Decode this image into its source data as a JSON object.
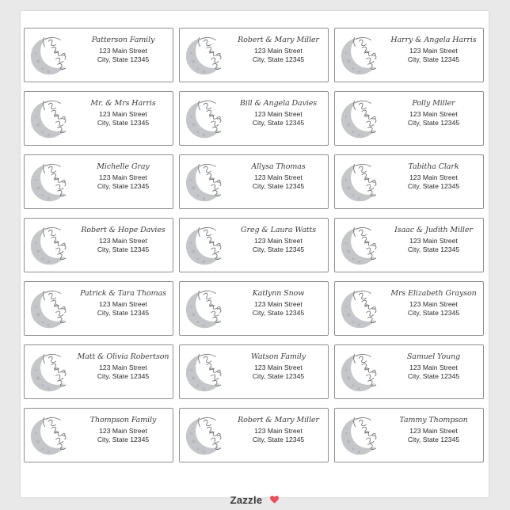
{
  "artwork": {
    "script_text": "I love you to the moon"
  },
  "labels": [
    {
      "name": "Patterson Family",
      "line1": "123 Main Street",
      "line2": "City, State 12345"
    },
    {
      "name": "Robert & Mary Miller",
      "line1": "123 Main Street",
      "line2": "City, State 12345"
    },
    {
      "name": "Harry & Angela Harris",
      "line1": "123 Main Street",
      "line2": "City, State 12345"
    },
    {
      "name": "Mr. & Mrs Harris",
      "line1": "123 Main Street",
      "line2": "City, State 12345"
    },
    {
      "name": "Bill & Angela Davies",
      "line1": "123 Main Street",
      "line2": "City, State 12345"
    },
    {
      "name": "Polly Miller",
      "line1": "123 Main Street",
      "line2": "City, State 12345"
    },
    {
      "name": "Michelle Gray",
      "line1": "123 Main Street",
      "line2": "City, State 12345"
    },
    {
      "name": "Allysa Thomas",
      "line1": "123 Main Street",
      "line2": "City, State 12345"
    },
    {
      "name": "Tabitha Clark",
      "line1": "123 Main Street",
      "line2": "City, State 12345"
    },
    {
      "name": "Robert & Hope Davies",
      "line1": "123 Main Street",
      "line2": "City, State 12345"
    },
    {
      "name": "Greg & Laura Watts",
      "line1": "123 Main Street",
      "line2": "City, State 12345"
    },
    {
      "name": "Isaac & Judith Miller",
      "line1": "123 Main Street",
      "line2": "City, State 12345"
    },
    {
      "name": "Patrick & Tara Thomas",
      "line1": "123 Main Street",
      "line2": "City, State 12345"
    },
    {
      "name": "Katlynn Snow",
      "line1": "123 Main Street",
      "line2": "City, State 12345"
    },
    {
      "name": "Mrs Elizabeth Grayson",
      "line1": "123 Main Street",
      "line2": "City, State 12345"
    },
    {
      "name": "Matt & Olivia Robertson",
      "line1": "123 Main Street",
      "line2": "City, State 12345"
    },
    {
      "name": "Watson Family",
      "line1": "123 Main Street",
      "line2": "City, State 12345"
    },
    {
      "name": "Samuel Young",
      "line1": "123 Main Street",
      "line2": "City, State 12345"
    },
    {
      "name": "Thompson Family",
      "line1": "123 Main Street",
      "line2": "City, State 12345"
    },
    {
      "name": "Robert & Mary Miller",
      "line1": "123 Main Street",
      "line2": "City, State 12345"
    },
    {
      "name": "Tammy Thompson",
      "line1": "123 Main Street",
      "line2": "City, State 12345"
    }
  ],
  "footer": {
    "brand": "Zazzle",
    "heart_icon": "heart-icon",
    "heart_color": "#e8505b"
  },
  "colors": {
    "moon_fill": "#c4c6ca",
    "moon_shade": "#a9acb1",
    "script": "#6a6a6a",
    "border": "#8f8f8f"
  }
}
